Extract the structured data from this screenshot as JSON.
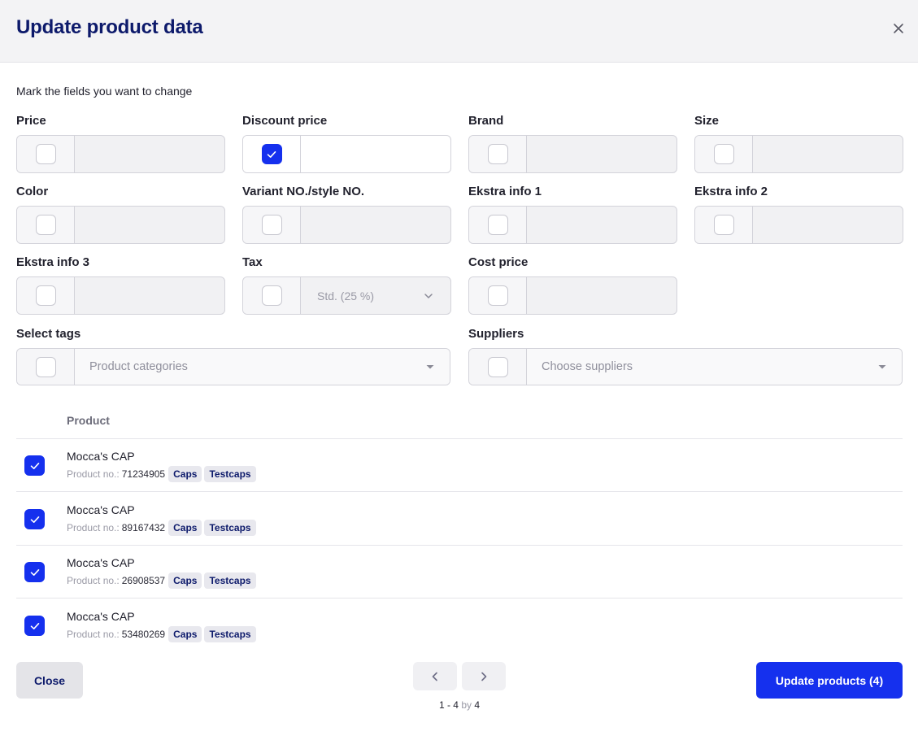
{
  "dialog": {
    "title": "Update product data",
    "hint": "Mark the fields you want to change"
  },
  "fields": {
    "price": {
      "label": "Price",
      "checked": false
    },
    "discount_price": {
      "label": "Discount price",
      "checked": true,
      "value": ""
    },
    "brand": {
      "label": "Brand",
      "checked": false
    },
    "size": {
      "label": "Size",
      "checked": false
    },
    "color": {
      "label": "Color",
      "checked": false
    },
    "variant_no": {
      "label": "Variant NO./style NO.",
      "checked": false
    },
    "ekstra_info_1": {
      "label": "Ekstra info 1",
      "checked": false
    },
    "ekstra_info_2": {
      "label": "Ekstra info 2",
      "checked": false
    },
    "ekstra_info_3": {
      "label": "Ekstra info 3",
      "checked": false
    },
    "tax": {
      "label": "Tax",
      "checked": false,
      "value": "Std. (25 %)"
    },
    "cost_price": {
      "label": "Cost price",
      "checked": false
    },
    "tags": {
      "label": "Select tags",
      "checked": false,
      "placeholder": "Product categories"
    },
    "suppliers": {
      "label": "Suppliers",
      "checked": false,
      "placeholder": "Choose suppliers"
    }
  },
  "table": {
    "header_product": "Product",
    "product_no_label": "Product no.:",
    "rows": [
      {
        "name": "Mocca's CAP",
        "product_no": "71234905",
        "tags": [
          "Caps",
          "Testcaps"
        ],
        "checked": true
      },
      {
        "name": "Mocca's CAP",
        "product_no": "89167432",
        "tags": [
          "Caps",
          "Testcaps"
        ],
        "checked": true
      },
      {
        "name": "Mocca's CAP",
        "product_no": "26908537",
        "tags": [
          "Caps",
          "Testcaps"
        ],
        "checked": true
      },
      {
        "name": "Mocca's CAP",
        "product_no": "53480269",
        "tags": [
          "Caps",
          "Testcaps"
        ],
        "checked": true
      }
    ]
  },
  "footer": {
    "close_label": "Close",
    "update_label": "Update products (4)",
    "pagination": {
      "range": "1 - 4",
      "by": "by",
      "total": "4"
    }
  },
  "icons": {
    "close": "close-icon",
    "check": "check-icon",
    "chevron_down": "chevron-down-icon",
    "caret_down": "caret-down-icon",
    "chevron_left": "chevron-left-icon",
    "chevron_right": "chevron-right-icon"
  },
  "colors": {
    "primary": "#1530ee",
    "title": "#0d1a6b",
    "header_bg": "#f3f3f5",
    "tag_bg": "#e8e8ee"
  }
}
